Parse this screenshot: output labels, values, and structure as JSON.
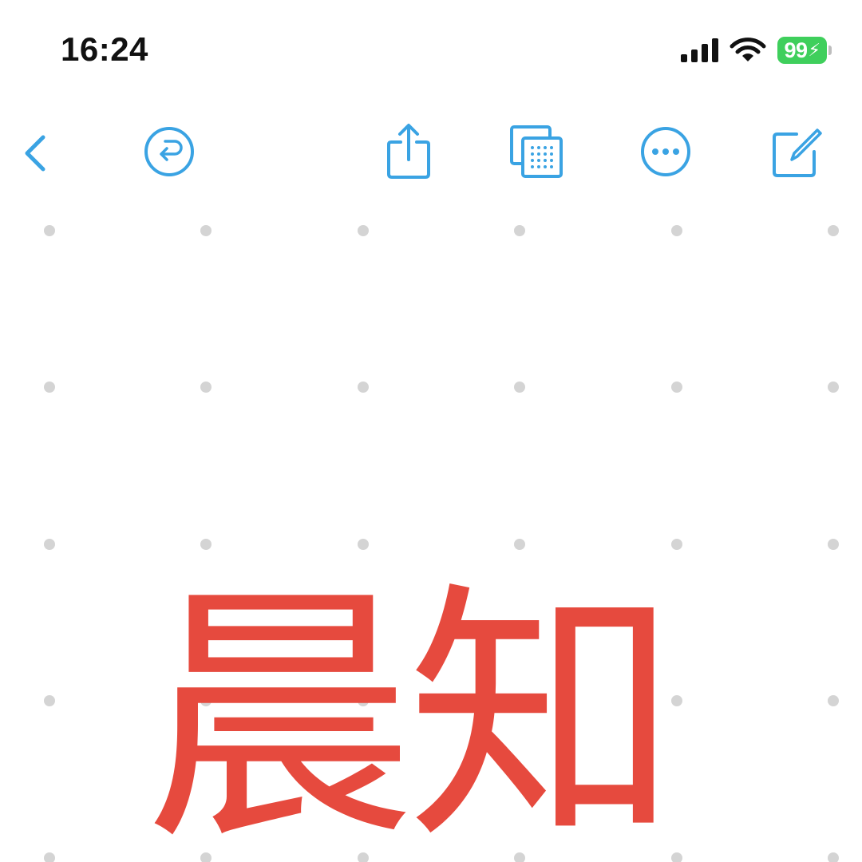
{
  "status_bar": {
    "time": "16:24",
    "battery_level": "99",
    "battery_color": "#3fcf5c",
    "icons": [
      "signal-icon",
      "wifi-icon",
      "battery-charging-icon"
    ]
  },
  "toolbar": {
    "accent_color": "#3aa3e3",
    "buttons": [
      {
        "name": "back-button",
        "icon": "chevron-left-icon"
      },
      {
        "name": "undo-button",
        "icon": "undo-circle-icon"
      },
      {
        "name": "share-button",
        "icon": "share-icon"
      },
      {
        "name": "canvas-options-button",
        "icon": "layers-grid-icon"
      },
      {
        "name": "more-button",
        "icon": "ellipsis-circle-icon"
      },
      {
        "name": "new-note-button",
        "icon": "compose-icon"
      }
    ]
  },
  "canvas": {
    "background": "dot-grid",
    "ink_color": "#e64a3e",
    "handwritten_text": "晨知"
  }
}
